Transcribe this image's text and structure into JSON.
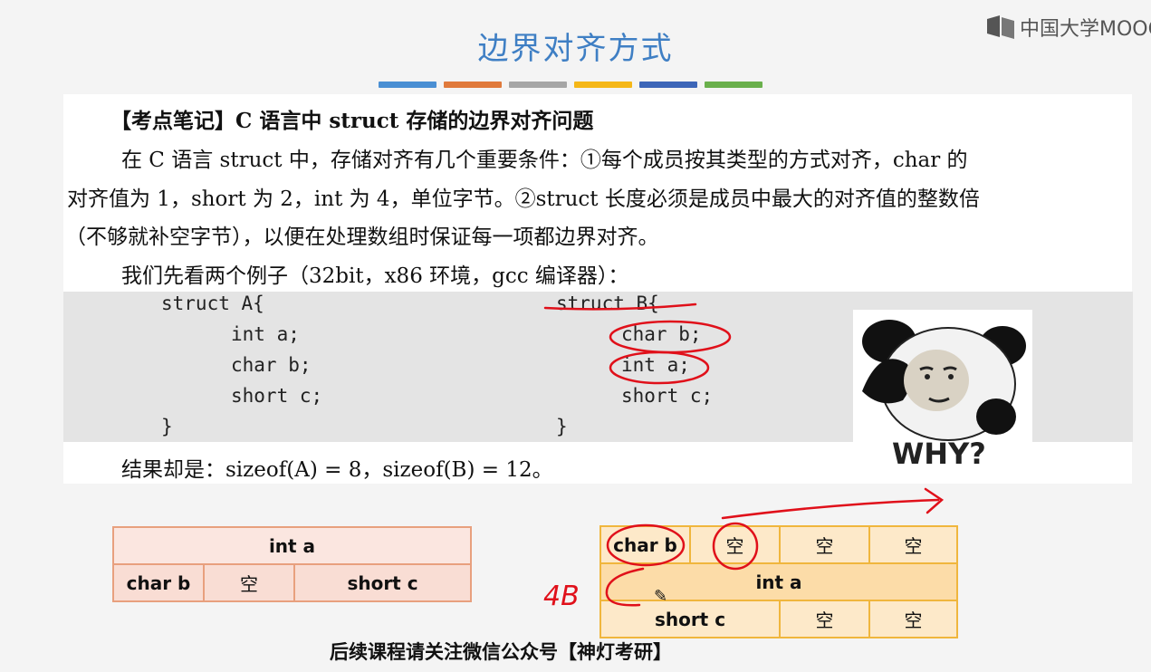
{
  "title": "边界对齐方式",
  "logo": {
    "text": "中国大学MOOC"
  },
  "colors": {
    "title": "#3f7fc4",
    "bars": [
      "#4a8fd3",
      "#e07a3c",
      "#a6a6a6",
      "#f5b718",
      "#3d66b8",
      "#6ab04c"
    ],
    "annotation": "#e0101a"
  },
  "notes": {
    "heading": "【考点笔记】C 语言中 struct 存储的边界对齐问题",
    "line1": "在 C 语言 struct 中，存储对齐有几个重要条件：①每个成员按其类型的方式对齐，char 的",
    "line2": "对齐值为 1，short 为 2，int 为 4，单位字节。②struct 长度必须是成员中最大的对齐值的整数倍",
    "line3": "（不够就补空字节），以便在处理数组时保证每一项都边界对齐。",
    "line4": "我们先看两个例子（32bit，x86 环境，gcc 编译器）：",
    "result": "结果却是：sizeof(A) = 8，sizeof(B) = 12。"
  },
  "code": {
    "structA": [
      "struct A{",
      "int a;",
      "char b;",
      "short c;",
      "}"
    ],
    "structB": [
      "struct B{",
      "char b;",
      "int a;",
      "short c;",
      "}"
    ]
  },
  "meme": {
    "caption": "WHY?"
  },
  "tableA": {
    "row1": [
      "int a"
    ],
    "row2": [
      "char b",
      "空",
      "short c"
    ]
  },
  "tableB": {
    "row1": [
      "char b",
      "空",
      "空",
      "空"
    ],
    "row2": [
      "int a"
    ],
    "row3": [
      "short c",
      "空",
      "空"
    ]
  },
  "handwriting": {
    "label": "4B"
  },
  "footer": {
    "notice": "后续课程请关注微信公众号【神灯考研】"
  }
}
